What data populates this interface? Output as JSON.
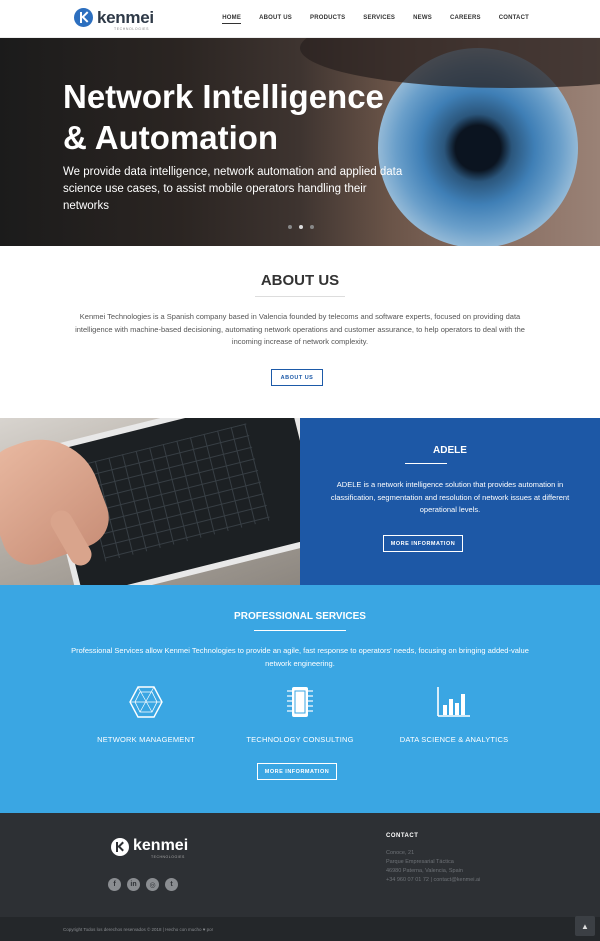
{
  "brand": {
    "name": "kenmei",
    "tagline": "TECHNOLOGIES",
    "accent": "#1d58a6",
    "light_accent": "#3aa6e3"
  },
  "nav": {
    "items": [
      {
        "label": "HOME",
        "active": true
      },
      {
        "label": "ABOUT US"
      },
      {
        "label": "PRODUCTS"
      },
      {
        "label": "SERVICES"
      },
      {
        "label": "NEWS"
      },
      {
        "label": "CAREERS"
      },
      {
        "label": "CONTACT"
      }
    ]
  },
  "hero": {
    "title_line1": "Network Intelligence",
    "title_line2": "& Automation",
    "subtitle": "We provide data intelligence, network automation and applied data science use cases, to assist mobile operators handling their networks",
    "slides": 3,
    "active_slide": 2
  },
  "about": {
    "title": "ABOUT US",
    "text": "Kenmei Technologies is a Spanish company based in Valencia founded by telecoms and software experts, focused on providing data intelligence with machine-based decisioning, automating network operations and customer assurance, to help operators to deal with the incoming increase of network complexity.",
    "button": "ABOUT US"
  },
  "adele": {
    "title": "ADELE",
    "text": "ADELE is a network intelligence solution that provides automation in classification, segmentation and resolution of network issues at different operational levels.",
    "button": "MORE INFORMATION"
  },
  "services": {
    "title": "PROFESSIONAL SERVICES",
    "text": "Professional Services allow Kenmei Technologies to provide an agile, fast response to operators' needs, focusing on bringing added-value network engineering.",
    "items": [
      {
        "label": "NETWORK MANAGEMENT",
        "icon": "network-icon"
      },
      {
        "label": "TECHNOLOGY CONSULTING",
        "icon": "chip-icon"
      },
      {
        "label": "DATA SCIENCE & ANALYTICS",
        "icon": "bar-chart-icon"
      }
    ],
    "button": "MORE INFORMATION"
  },
  "footer": {
    "logo": "kenmei",
    "logo_sub": "TECHNOLOGIES",
    "social": [
      {
        "icon": "facebook-icon",
        "glyph": "f"
      },
      {
        "icon": "linkedin-icon",
        "glyph": "in"
      },
      {
        "icon": "instagram-icon",
        "glyph": "◎"
      },
      {
        "icon": "twitter-icon",
        "glyph": "t"
      }
    ],
    "contact_title": "CONTACT",
    "contact_lines": [
      "Conoce, 21",
      "Parque Empresarial Táctica",
      "46980 Paterna, Valencia, Spain",
      "+34 960 07 01 72 | contact@kenmei.ai"
    ],
    "copyright": "Copyright Todos los derechos reservados © 2018 | Hecho con mucho ♥ por"
  }
}
